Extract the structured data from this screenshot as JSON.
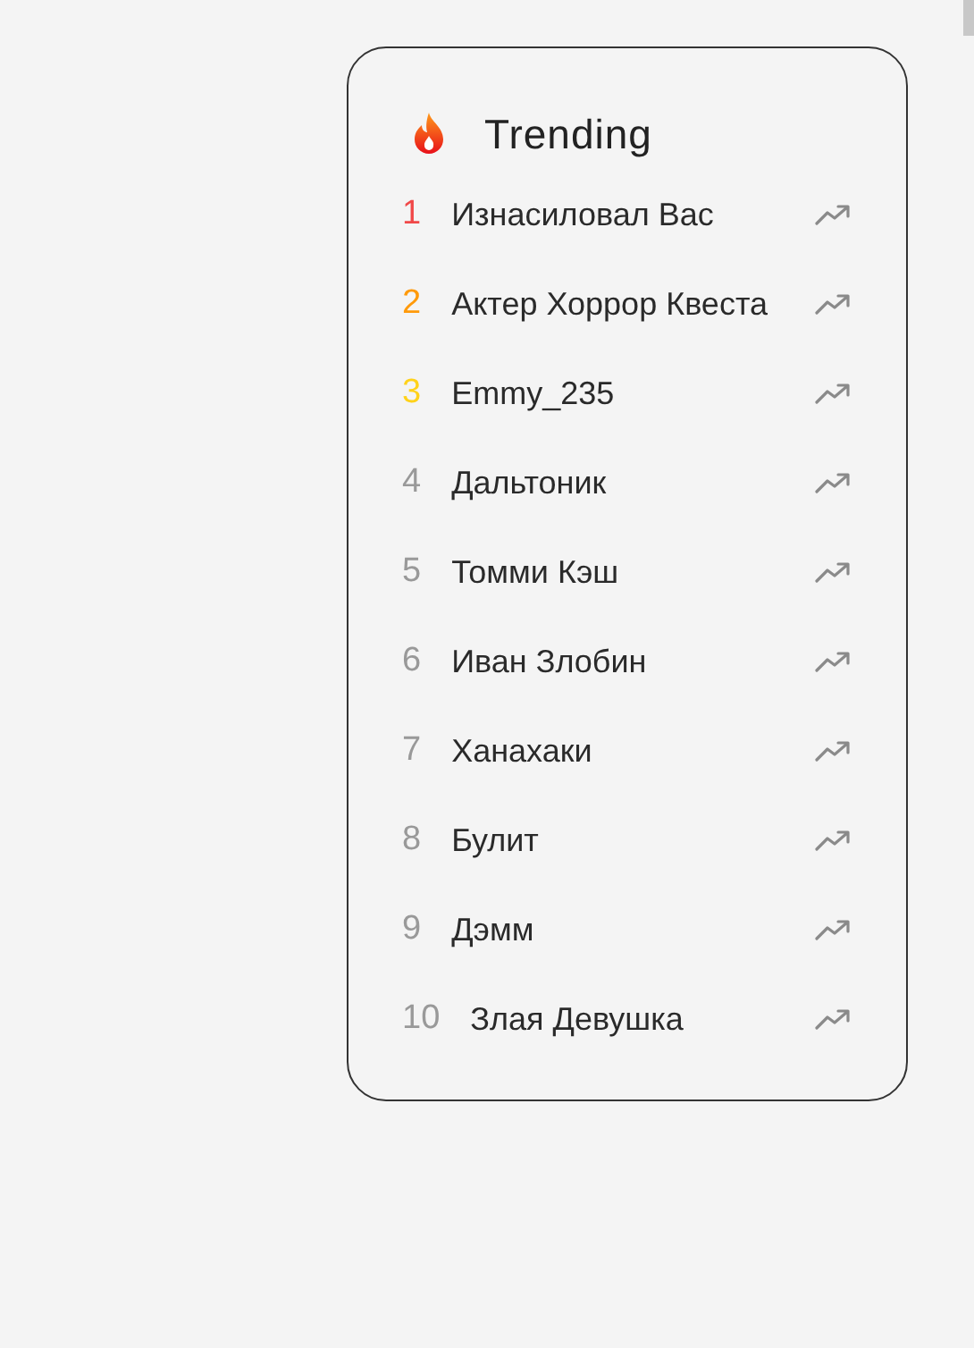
{
  "trending": {
    "title": "Trending",
    "items": [
      {
        "rank": "1",
        "name": "Изнасиловал Вас",
        "color": "#f04848"
      },
      {
        "rank": "2",
        "name": "Актер Хоррор Квеста",
        "color": "#ff9a0a"
      },
      {
        "rank": "3",
        "name": "Emmy_235",
        "color": "#ffd21a"
      },
      {
        "rank": "4",
        "name": "Дальтоник",
        "color": "#999999"
      },
      {
        "rank": "5",
        "name": "Томми Кэш",
        "color": "#999999"
      },
      {
        "rank": "6",
        "name": "Иван Злобин",
        "color": "#999999"
      },
      {
        "rank": "7",
        "name": "Ханахаки",
        "color": "#999999"
      },
      {
        "rank": "8",
        "name": "Булит",
        "color": "#999999"
      },
      {
        "rank": "9",
        "name": "Дэмм",
        "color": "#999999"
      },
      {
        "rank": "10",
        "name": "Злая Девушка",
        "color": "#999999"
      }
    ]
  }
}
